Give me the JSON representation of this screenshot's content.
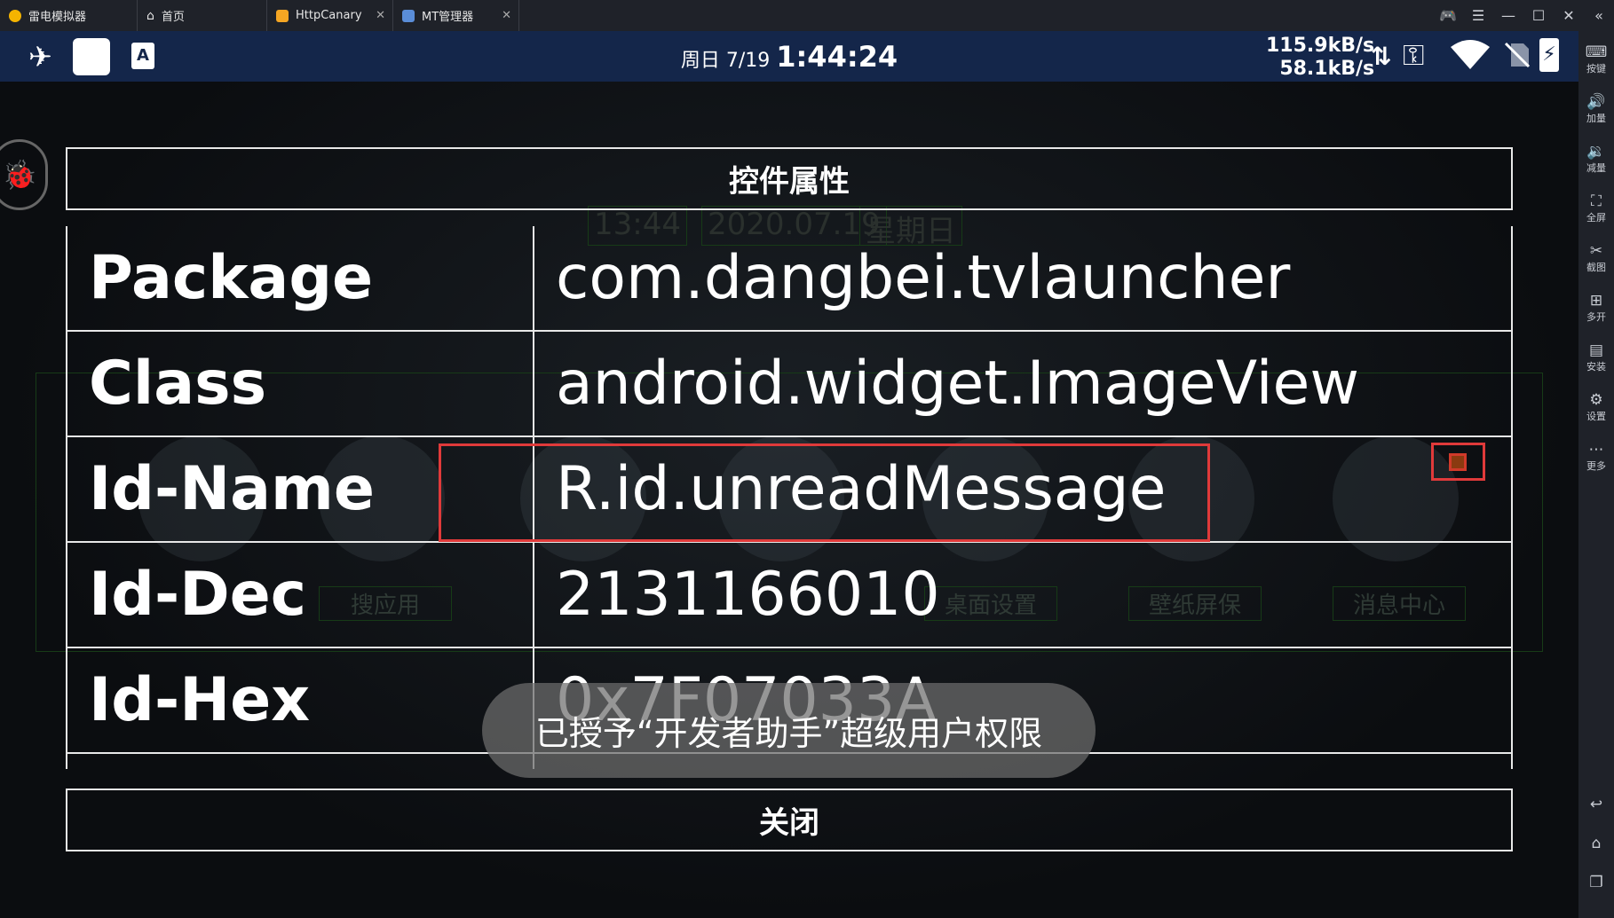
{
  "titlebar": {
    "tabs": [
      {
        "label": "雷电模拟器",
        "color": "#f5b400"
      },
      {
        "label": "首页",
        "color": "#cfd2d8"
      },
      {
        "label": "HttpCanary",
        "color": "#f5a623"
      },
      {
        "label": "MT管理器",
        "color": "#5a8dd8"
      }
    ],
    "controls": [
      "gamepad-icon",
      "menu-icon",
      "minimize-icon",
      "maximize-icon",
      "close-icon",
      "collapse-icon"
    ]
  },
  "statusbar": {
    "date": "周日 7/19",
    "time": "1:44:24",
    "net_down": "115.9kB/s",
    "net_up": "58.1kB/s"
  },
  "sidetool": [
    {
      "label": "按键",
      "icon": "keyboard-icon"
    },
    {
      "label": "加量",
      "icon": "volume-up-icon"
    },
    {
      "label": "减量",
      "icon": "volume-down-icon"
    },
    {
      "label": "全屏",
      "icon": "fullscreen-icon"
    },
    {
      "label": "截图",
      "icon": "scissors-icon"
    },
    {
      "label": "多开",
      "icon": "multi-instance-icon"
    },
    {
      "label": "安装",
      "icon": "apk-icon"
    },
    {
      "label": "设置",
      "icon": "gear-icon"
    },
    {
      "label": "更多",
      "icon": "more-icon"
    }
  ],
  "background": {
    "top": [
      "13:44",
      "2020.07.19",
      "星期日"
    ],
    "labels": [
      "搜应用",
      "桌面设置",
      "壁纸屏保",
      "消息中心"
    ]
  },
  "dialog": {
    "title": "控件属性",
    "rows": [
      {
        "key": "Package",
        "value": "com.dangbei.tvlauncher"
      },
      {
        "key": "Class",
        "value": "android.widget.ImageView"
      },
      {
        "key": "Id-Name",
        "value": "R.id.unreadMessage"
      },
      {
        "key": "Id-Dec",
        "value": "2131166010"
      },
      {
        "key": "Id-Hex",
        "value": "0x7F07033A"
      }
    ],
    "close_label": "关闭"
  },
  "toast": "已授予“开发者助手”超级用户权限",
  "colors": {
    "highlight": "#e03a3a",
    "statusbar": "#14264a"
  }
}
